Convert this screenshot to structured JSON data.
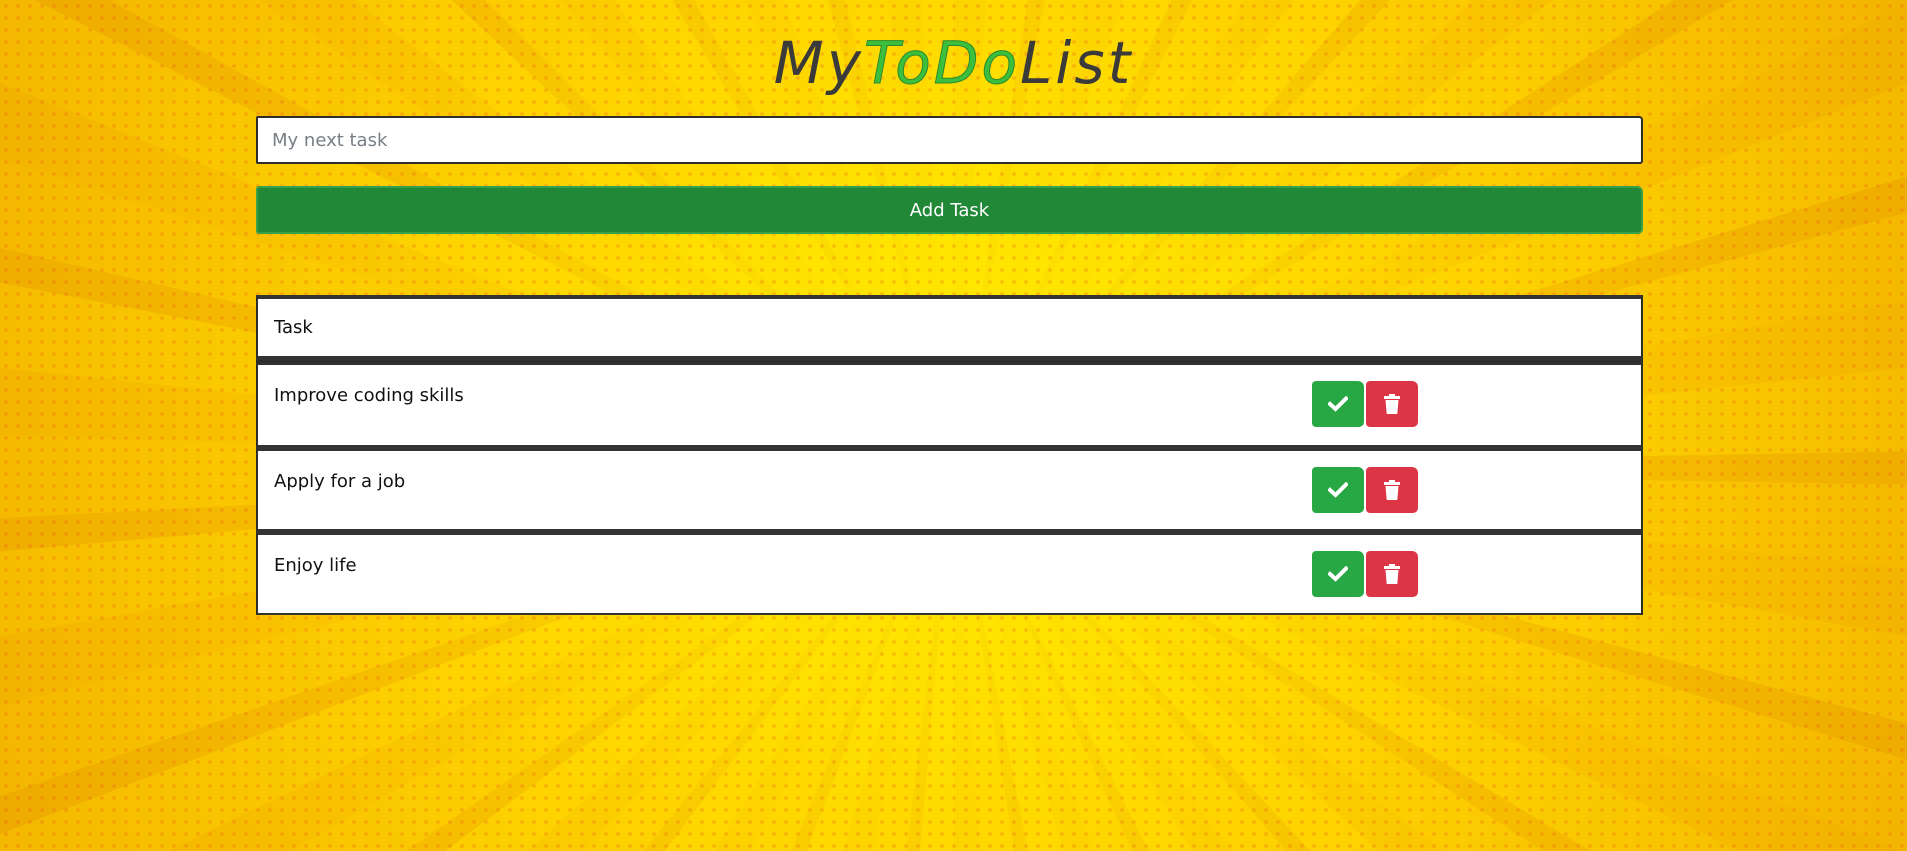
{
  "app": {
    "title_parts": [
      "My",
      "ToDo",
      "List"
    ]
  },
  "form": {
    "input_placeholder": "My next task",
    "input_value": "",
    "add_label": "Add Task"
  },
  "table": {
    "header": "Task",
    "tasks": [
      {
        "text": "Improve coding skills"
      },
      {
        "text": "Apply for a job"
      },
      {
        "text": "Enjoy life"
      }
    ]
  },
  "icons": {
    "done": "check-icon",
    "delete": "trash-icon"
  },
  "colors": {
    "done_button": "#28a745",
    "delete_button": "#dc3545",
    "add_button": "#218838",
    "title_accent": "#3cbf3c"
  }
}
